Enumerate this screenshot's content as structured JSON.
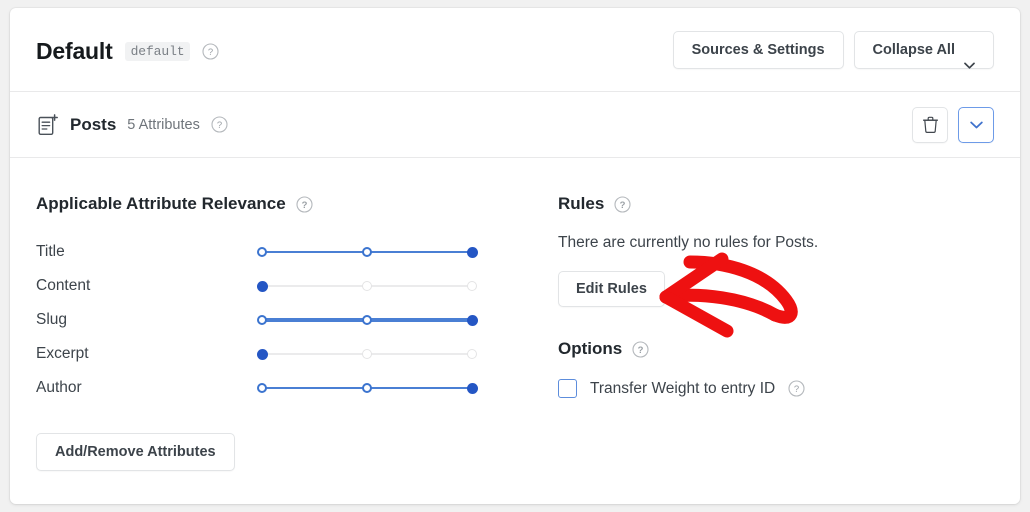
{
  "header": {
    "title": "Default",
    "code_badge": "default",
    "help_icon": "question-circle-icon",
    "buttons": {
      "sources_settings": "Sources & Settings",
      "collapse_all": "Collapse All",
      "collapse_caret_icon": "chevron-down-icon"
    }
  },
  "section": {
    "icon": "document-plus-icon",
    "name": "Posts",
    "meta": "5 Attributes",
    "help_icon": "question-circle-icon",
    "actions": {
      "delete_icon": "trash-icon",
      "expand_icon": "chevron-down-icon"
    }
  },
  "relevance": {
    "heading": "Applicable Attribute Relevance",
    "help_icon": "question-circle-icon",
    "attributes": [
      {
        "label": "Title",
        "value": 2,
        "track_on": true,
        "thick": false
      },
      {
        "label": "Content",
        "value": 0,
        "track_on": false,
        "thick": false
      },
      {
        "label": "Slug",
        "value": 2,
        "track_on": true,
        "thick": true
      },
      {
        "label": "Excerpt",
        "value": 0,
        "track_on": false,
        "thick": false
      },
      {
        "label": "Author",
        "value": 2,
        "track_on": true,
        "thick": false
      }
    ],
    "add_remove_button": "Add/Remove Attributes"
  },
  "rules": {
    "heading": "Rules",
    "help_icon": "question-circle-icon",
    "empty_text": "There are currently no rules for Posts.",
    "edit_button": "Edit Rules"
  },
  "options": {
    "heading": "Options",
    "help_icon": "question-circle-icon",
    "transfer_weight": {
      "label": "Transfer Weight to entry ID",
      "checked": false,
      "help_icon": "question-circle-icon"
    }
  },
  "annotation": {
    "type": "red-arrow",
    "color": "#ee1111",
    "points_to": "Edit Rules"
  },
  "colors": {
    "page_background": "#f1f1f1",
    "card_background": "#ffffff",
    "accent_blue": "#2456c4",
    "text_primary": "#22282e",
    "text_secondary": "#6f757b",
    "annotation_red": "#ee1111"
  }
}
